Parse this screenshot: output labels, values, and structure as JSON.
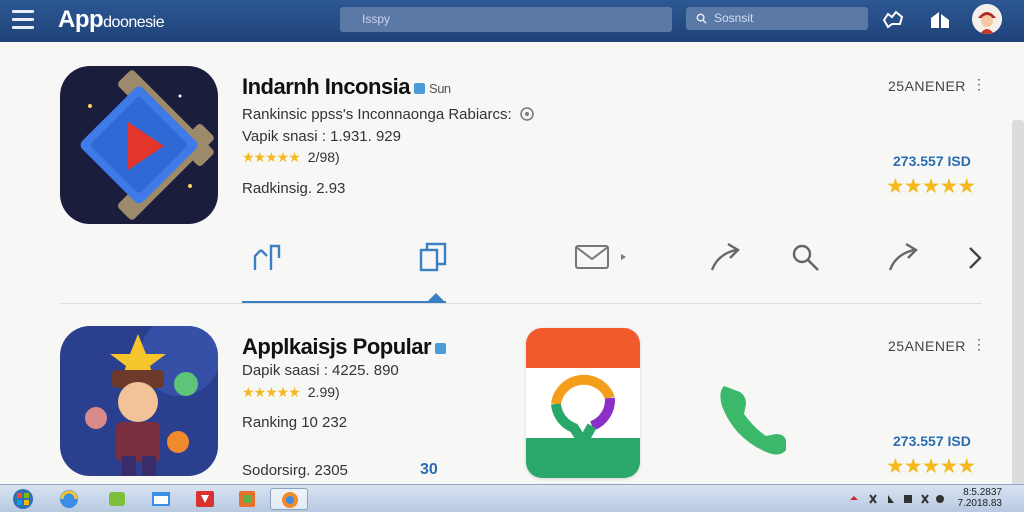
{
  "header": {
    "app_title_main": "App",
    "app_title_rest": "doonesie",
    "field_text": "Isspy",
    "search_placeholder": "Sosnsit"
  },
  "items": [
    {
      "name": "Indarnh Inconsia",
      "name_suffix": "Sun",
      "line1": "Rankinsic ppss's Inconnaonga Rabiarcs:",
      "line2": "Vapik snasi : 1.931. 929",
      "rating_stars": "★★★★★",
      "rating_text": "2/98)",
      "ranking": "Radkinsig. 2.93",
      "right_label": "25ANENER",
      "right_number": "273.557 ISD",
      "right_stars": "★★★★★"
    },
    {
      "name": "Applkaisjs Popular",
      "line1": "Dapik saasi : 4225. 890",
      "rating_stars": "★★★★★",
      "rating_text": "2.99)",
      "ranking": "Ranking 10 232",
      "bottom_line": "Sodorsirg. 2305",
      "bottom_link": "30",
      "right_label": "25ANENER",
      "right_number": "273.557 ISD",
      "right_stars": "★★★★★"
    }
  ],
  "actions": [
    "share-icon",
    "copy-icon",
    "mail-icon",
    "forward-icon",
    "search-icon",
    "send-icon",
    "next-icon"
  ],
  "taskbar": {
    "clock_time": "8:5.2837",
    "clock_date": "7.2018.83"
  },
  "colors": {
    "topbar": "#2d5893",
    "accent": "#3b80c4",
    "star": "#f3b91f",
    "link": "#2b6cb0"
  }
}
